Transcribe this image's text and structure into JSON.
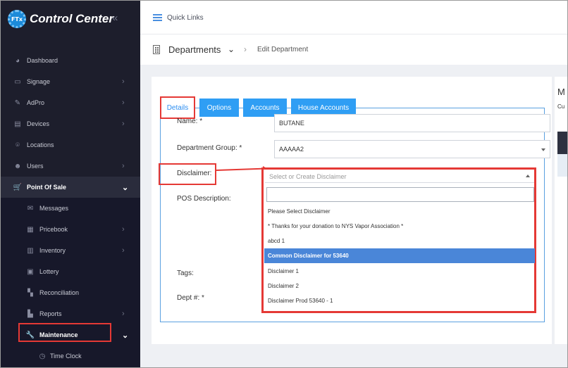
{
  "app": {
    "title": "Control Center",
    "logo_text": "FTx"
  },
  "sidebar": {
    "items": [
      {
        "label": "Dashboard",
        "icon": "dashboard-icon",
        "glyph": "◕"
      },
      {
        "label": "Signage",
        "icon": "monitor-icon",
        "glyph": "▭",
        "chevron": "›"
      },
      {
        "label": "AdPro",
        "icon": "brush-icon",
        "glyph": "✎",
        "chevron": "›"
      },
      {
        "label": "Devices",
        "icon": "devices-icon",
        "glyph": "▤",
        "chevron": "›"
      },
      {
        "label": "Locations",
        "icon": "location-pin-icon",
        "glyph": "⌾"
      },
      {
        "label": "Users",
        "icon": "users-icon",
        "glyph": "☻",
        "chevron": "›"
      },
      {
        "label": "Point Of Sale",
        "icon": "cart-icon",
        "glyph": "🛒",
        "chevron": "⌄"
      }
    ],
    "subitems": [
      {
        "label": "Messages",
        "icon": "message-icon",
        "glyph": "✉"
      },
      {
        "label": "Pricebook",
        "icon": "pricebook-icon",
        "glyph": "▦",
        "chevron": "›"
      },
      {
        "label": "Inventory",
        "icon": "inventory-icon",
        "glyph": "▥",
        "chevron": "›"
      },
      {
        "label": "Lottery",
        "icon": "lottery-icon",
        "glyph": "▣"
      },
      {
        "label": "Reconciliation",
        "icon": "reconciliation-icon",
        "glyph": "▚"
      },
      {
        "label": "Reports",
        "icon": "reports-icon",
        "glyph": "▙",
        "chevron": "›"
      },
      {
        "label": "Maintenance",
        "icon": "wrench-icon",
        "glyph": "🔧",
        "chevron": "⌄"
      }
    ],
    "subsub": {
      "label": "Time Clock",
      "icon": "clock-icon",
      "glyph": "◷"
    }
  },
  "topbar": {
    "quick_links": "Quick Links"
  },
  "breadcrumb": {
    "section": "Departments",
    "current": "Edit Department"
  },
  "tabs": [
    "Details",
    "Options",
    "Accounts",
    "House Accounts"
  ],
  "form": {
    "name_label": "Name: *",
    "name_value": "BUTANE",
    "group_label": "Department Group: *",
    "group_value": "AAAAA2",
    "disclaimer_label": "Disclaimer:",
    "pos_label": "POS Description:",
    "tags_label": "Tags:",
    "dept_label": "Dept #: *"
  },
  "disclaimer_dropdown": {
    "placeholder": "Select or Create Disclaimer",
    "search_value": "",
    "options": [
      "Please Select Disclaimer",
      "* Thanks for your donation to NYS Vapor Association *",
      "abcd 1",
      "Common Disclaimer for 53640",
      "Disclaimer 1",
      "Disclaimer 2",
      "Disclaimer Prod 53640 - 1"
    ],
    "selected_index": 3
  },
  "right_panel": {
    "title_fragment": "M",
    "sub_fragment": "Cu"
  },
  "colors": {
    "accent": "#2f9ef4",
    "highlight": "#e53935",
    "sidebar": "#1d1e2c",
    "selected_option": "#4a86d8"
  }
}
